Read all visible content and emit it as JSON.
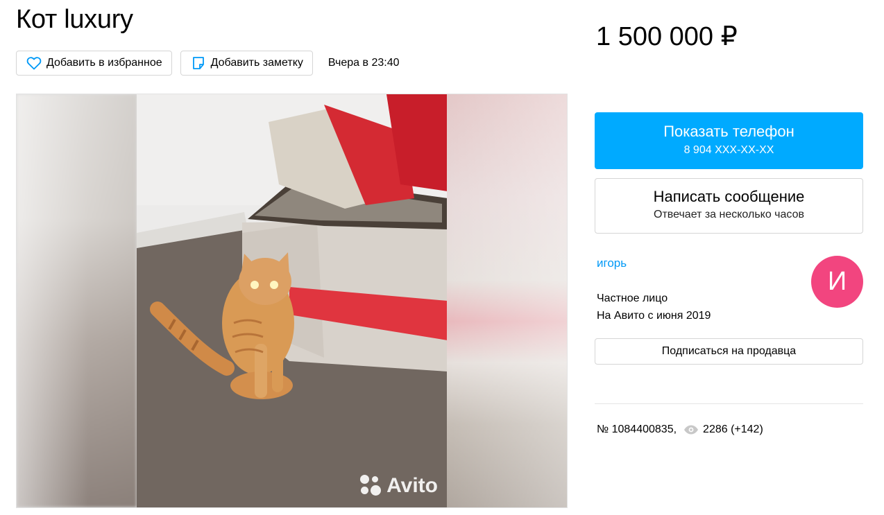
{
  "listing": {
    "title": "Кот luxury",
    "price": "1 500 000 ₽",
    "date": "Вчера в 23:40"
  },
  "actions": {
    "favorite_label": "Добавить в избранное",
    "note_label": "Добавить заметку"
  },
  "gallery": {
    "watermark_text": "Avito"
  },
  "contact": {
    "phone_button_label": "Показать телефон",
    "phone_masked": "8 904 XXX-XX-XX",
    "message_button_label": "Написать сообщение",
    "message_subtitle": "Отвечает за несколько часов"
  },
  "seller": {
    "name": "игорь",
    "avatar_letter": "И",
    "type": "Частное лицо",
    "since": "На Авито с июня 2019",
    "subscribe_label": "Подписаться на продавца"
  },
  "meta": {
    "listing_number": "№ 1084400835,",
    "views": "2286 (+142)"
  },
  "colors": {
    "accent": "#00aaff",
    "link": "#0099f7",
    "avatar_bg": "#f2457f"
  }
}
